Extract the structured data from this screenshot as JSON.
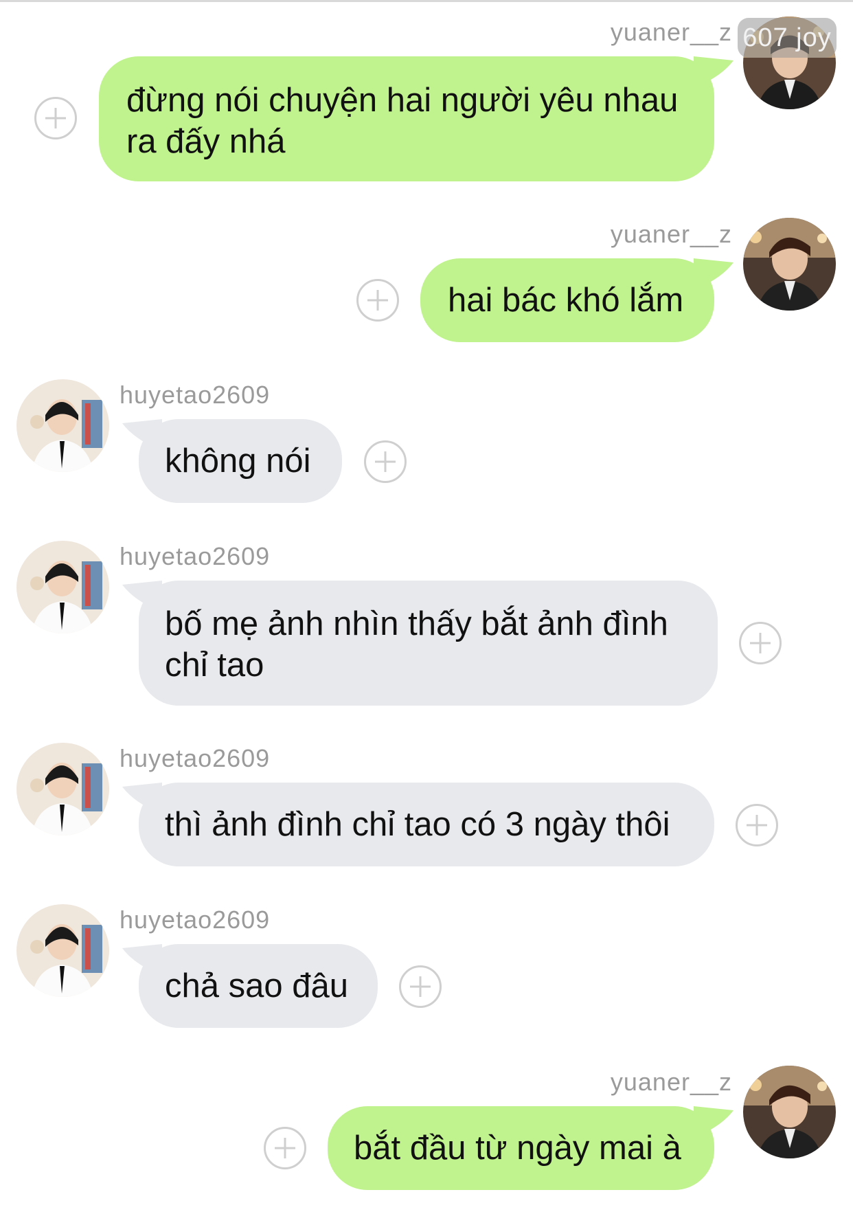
{
  "conversation": {
    "messages": [
      {
        "sender": "yuaner__z",
        "text": "đừng nói chuyện hai người yêu nhau ra đấy nhá"
      },
      {
        "sender": "yuaner__z",
        "text": "hai bác khó lắm"
      },
      {
        "sender": "huyetao2609",
        "text": "không nói"
      },
      {
        "sender": "huyetao2609",
        "text": "bố mẹ ảnh nhìn thấy bắt ảnh đình chỉ tao"
      },
      {
        "sender": "huyetao2609",
        "text": "thì ảnh đình chỉ tao có 3 ngày thôi"
      },
      {
        "sender": "huyetao2609",
        "text": "chả sao đâu"
      },
      {
        "sender": "yuaner__z",
        "text": "bắt đầu từ ngày mai à"
      }
    ]
  },
  "watermark": {
    "text": "607 joy"
  },
  "colors": {
    "outgoing_bubble": "#c0f28e",
    "incoming_bubble": "#e7e9ec",
    "username": "#9a9a9a",
    "add_button": "#cfcfcf"
  },
  "icons": {
    "add_button": "plus-circle-icon",
    "avatar": "profile-photo"
  }
}
